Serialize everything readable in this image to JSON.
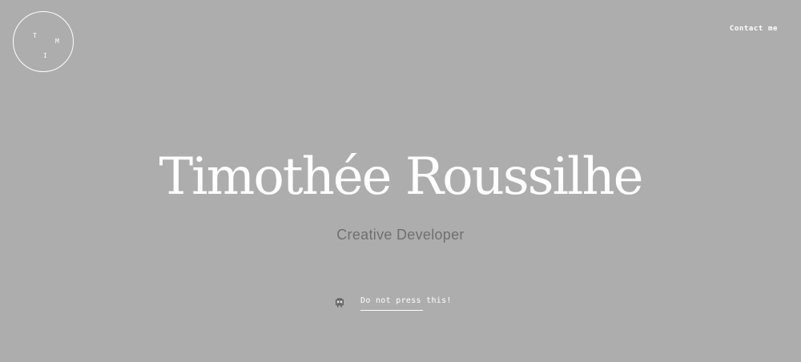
{
  "header": {
    "logo": {
      "letters": [
        "T",
        "M",
        "I"
      ]
    },
    "contact_label": "Contact me"
  },
  "hero": {
    "title": "Timothée Roussilhe",
    "subtitle": "Creative Developer"
  },
  "cta": {
    "icon": "robot-icon",
    "label": "Do not press this!"
  },
  "colors": {
    "background": "#adadad",
    "text_primary": "#ffffff",
    "text_secondary": "#6f6f6f"
  }
}
